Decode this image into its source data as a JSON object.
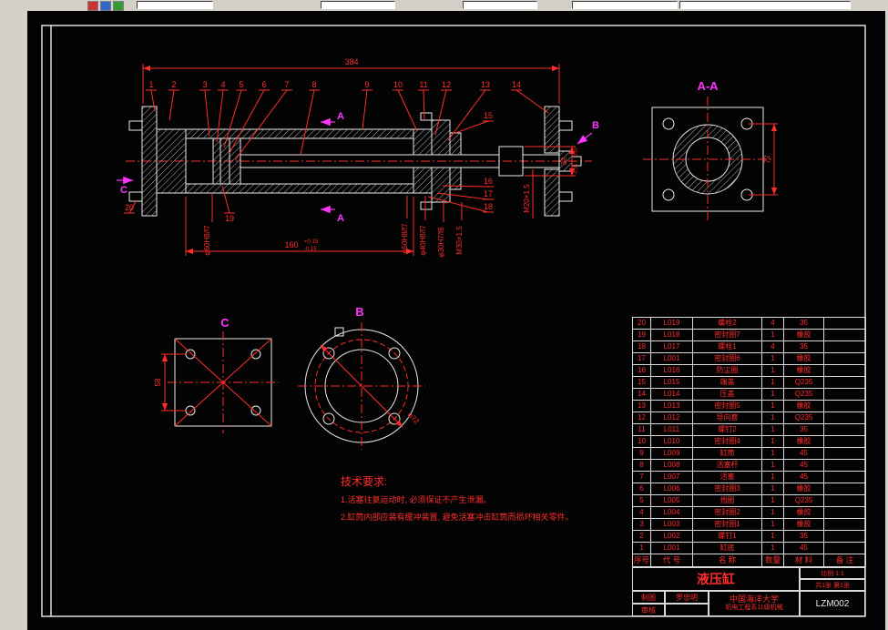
{
  "toolbar": {
    "field_values": [
      "",
      "",
      "",
      "",
      ""
    ]
  },
  "views": {
    "section_aa": "A-A",
    "view_b": "B",
    "view_c": "C",
    "arrow_a": "A",
    "arrow_b": "B",
    "arrow_c": "C"
  },
  "callouts": [
    "1",
    "2",
    "3",
    "4",
    "5",
    "6",
    "7",
    "8",
    "9",
    "10",
    "11",
    "12",
    "13",
    "14",
    "15",
    "16",
    "17",
    "18",
    "19",
    "20"
  ],
  "dims": {
    "overall": "384",
    "length": "160",
    "length_tol_up": "+0.15",
    "length_tol_dn": "-0.15",
    "fit_left": "φ60H8/f7",
    "fit_1": "φ50H8/f7",
    "fit_2": "φ40H8/f7",
    "fit_3": "φ30H7/f6",
    "fit_4": "M30×1.5",
    "step": "32",
    "step_tol_up": "-0.10",
    "step_tol_dn": "-0.35",
    "rod_thread": "M20×1.5",
    "aa_size": "72",
    "c_size": "58",
    "b_size": "φ72"
  },
  "tech": {
    "title": "技术要求:",
    "line1": "1.活塞往复运动时, 必须保证不产生泄漏。",
    "line2": "2.缸筒内部应装有缓冲装置, 避免活塞冲击缸筒而损坏相关零件。"
  },
  "bom": {
    "headers": {
      "no": "序号",
      "code": "代 号",
      "name": "名 称",
      "qty": "数量",
      "material": "材 料",
      "note": "备 注"
    },
    "rows": [
      {
        "no": "20",
        "code": "L019",
        "name": "螺栓2",
        "qty": "4",
        "material": "35",
        "note": ""
      },
      {
        "no": "19",
        "code": "L018",
        "name": "密封圈7",
        "qty": "1",
        "material": "橡胶",
        "note": ""
      },
      {
        "no": "18",
        "code": "L017",
        "name": "螺栓1",
        "qty": "4",
        "material": "35",
        "note": ""
      },
      {
        "no": "17",
        "code": "L001",
        "name": "密封圈6",
        "qty": "1",
        "material": "橡胶",
        "note": ""
      },
      {
        "no": "16",
        "code": "L016",
        "name": "防尘圈",
        "qty": "1",
        "material": "橡胶",
        "note": ""
      },
      {
        "no": "15",
        "code": "L015",
        "name": "端盖",
        "qty": "1",
        "material": "Q235",
        "note": ""
      },
      {
        "no": "14",
        "code": "L014",
        "name": "压盖",
        "qty": "1",
        "material": "Q235",
        "note": ""
      },
      {
        "no": "13",
        "code": "L013",
        "name": "密封圈5",
        "qty": "1",
        "material": "橡胶",
        "note": ""
      },
      {
        "no": "12",
        "code": "L012",
        "name": "导向套",
        "qty": "1",
        "material": "Q235",
        "note": ""
      },
      {
        "no": "11",
        "code": "L011",
        "name": "螺钉2",
        "qty": "1",
        "material": "35",
        "note": ""
      },
      {
        "no": "10",
        "code": "L010",
        "name": "密封圈4",
        "qty": "1",
        "material": "橡胶",
        "note": ""
      },
      {
        "no": "9",
        "code": "L009",
        "name": "缸筒",
        "qty": "1",
        "material": "45",
        "note": ""
      },
      {
        "no": "8",
        "code": "L008",
        "name": "活塞杆",
        "qty": "1",
        "material": "45",
        "note": ""
      },
      {
        "no": "7",
        "code": "L007",
        "name": "活塞",
        "qty": "1",
        "material": "45",
        "note": ""
      },
      {
        "no": "6",
        "code": "L006",
        "name": "密封圈3",
        "qty": "1",
        "material": "橡胶",
        "note": ""
      },
      {
        "no": "5",
        "code": "L005",
        "name": "挡圈",
        "qty": "1",
        "material": "Q235",
        "note": ""
      },
      {
        "no": "4",
        "code": "L004",
        "name": "密封圈2",
        "qty": "1",
        "material": "橡胶",
        "note": ""
      },
      {
        "no": "3",
        "code": "L003",
        "name": "密封圈1",
        "qty": "1",
        "material": "橡胶",
        "note": ""
      },
      {
        "no": "2",
        "code": "L002",
        "name": "螺钉1",
        "qty": "1",
        "material": "35",
        "note": ""
      },
      {
        "no": "1",
        "code": "L001",
        "name": "缸底",
        "qty": "1",
        "material": "45",
        "note": ""
      }
    ]
  },
  "titleblock": {
    "title": "液压缸",
    "scale": "比例 1:1",
    "sheet": "共1张 第1张",
    "drawer_label": "制图",
    "drawer": "罗忠明",
    "checker_label": "审核",
    "checker": "",
    "org": "中国海洋大学",
    "dept": "机电工程系11级机械",
    "drawing_no": "LZM002"
  }
}
